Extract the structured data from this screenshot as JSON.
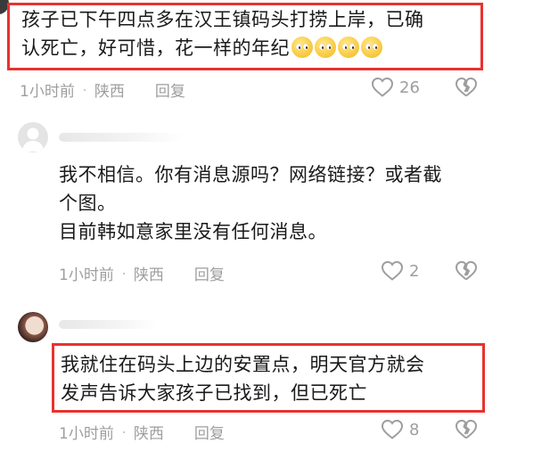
{
  "comment1": {
    "text_line1": "孩子已下午四点多在汉王镇码头打捞上岸，已确",
    "text_line2": "认死亡，好可惜，花一样的年纪",
    "emoji": [
      "pleading-face-emoji",
      "pleading-face-emoji",
      "pleading-face-emoji",
      "pleading-face-emoji"
    ],
    "time": "1小时前",
    "location": "陕西",
    "reply_label": "回复",
    "like_count": "26"
  },
  "comment2": {
    "text_line1": "我不相信。你有消息源吗？网络链接？或者截",
    "text_line2": "个图。",
    "text_line3": "目前韩如意家里没有任何消息。",
    "time": "1小时前",
    "location": "陕西",
    "reply_label": "回复",
    "like_count": "2"
  },
  "comment3": {
    "text_line1": "我就住在码头上边的安置点，明天官方就会",
    "text_line2": "发声告诉大家孩子已找到，但已死亡",
    "time": "1小时前",
    "location": "陕西",
    "reply_label": "回复",
    "like_count": "8"
  },
  "colors": {
    "highlight_border": "#e8322f",
    "meta_gray": "#9e9e9e"
  },
  "icons": [
    "heart-outline-icon",
    "broken-heart-icon",
    "default-avatar-icon"
  ]
}
